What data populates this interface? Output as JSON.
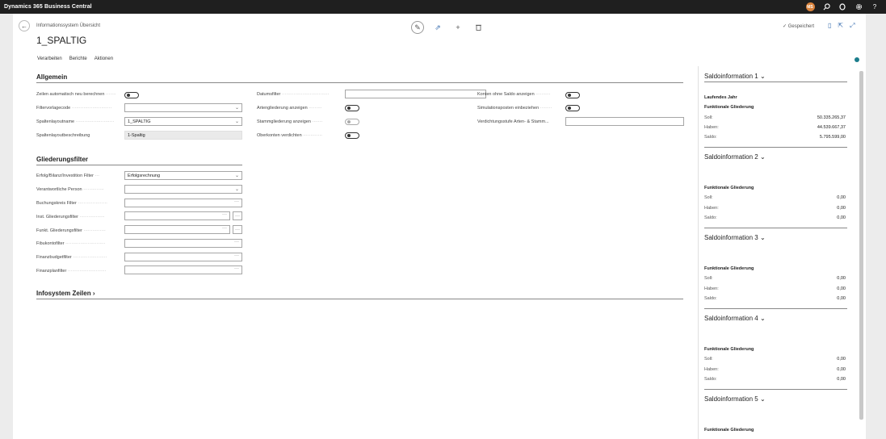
{
  "app": {
    "title": "Dynamics 365 Business Central",
    "avatar_initials": "MS"
  },
  "topbar_icons": [
    "search-icon",
    "notification-icon",
    "gear-icon",
    "help-icon"
  ],
  "header": {
    "breadcrumb": "Informationssystem Übersicht",
    "title": "1_SPALTIG",
    "saved_label": "Gespeichert",
    "saved_check": "✓"
  },
  "actions": [
    "Verarbeiten",
    "Berichte",
    "Aktionen"
  ],
  "allgemein": {
    "title": "Allgemein",
    "col1": {
      "recalc_label": "Zeilen automatisch neu berechnen",
      "filtertemplate_label": "Filtervorlagecode",
      "filtertemplate_value": "",
      "layoutname_label": "Spaltenlayoutname",
      "layoutname_value": "1_SPALTIG",
      "layoutdesc_label": "Spaltenlayoutbeschreibung",
      "layoutdesc_value": "1-Spaltig"
    },
    "col2": {
      "datefilter_label": "Datumsfilter",
      "datefilter_value": "",
      "artgliederung_label": "Artengliederung anzeigen",
      "stammgliederung_label": "Stammgliederung anzeigen",
      "oberkonten_label": "Oberkonten verdichten"
    },
    "col3": {
      "ohnesaldo_label": "Konten ohne Saldo anzeigen",
      "simulation_label": "Simulationsposten einbeziehen",
      "verdichtung_label": "Verdichtungsstufe Arten- & Stamm...",
      "verdichtung_value": ""
    }
  },
  "gliederung": {
    "title": "Gliederungsfilter",
    "rows": [
      {
        "label": "Erfolg/Bilanz/Investition Filter",
        "value": "Erfolgsrechnung"
      },
      {
        "label": "Verantwortliche Person",
        "value": ""
      },
      {
        "label": "Buchungskreis Filter",
        "value": ""
      },
      {
        "label": "Inst. Gliederungsfilter",
        "value": ""
      },
      {
        "label": "Funkt. Gliederungsfilter",
        "value": ""
      },
      {
        "label": "Fibukontofilter",
        "value": ""
      },
      {
        "label": "Finanzbudgetfilter",
        "value": ""
      },
      {
        "label": "Finanzplanfilter",
        "value": ""
      }
    ]
  },
  "infosystem": {
    "title": "Infosystem Zeilen",
    "chevron": "›"
  },
  "factbox": {
    "sections": [
      {
        "title": "Saldoinformation 1",
        "year": "Laufendes Jahr",
        "sub": "Funktionale Gliederung",
        "soll_label": "Soll:",
        "soll": "50.335.265,37",
        "haben_label": "Haben:",
        "haben": "44.539.667,37",
        "saldo_label": "Saldo:",
        "saldo": "5.795.599,00"
      },
      {
        "title": "Saldoinformation 2",
        "year": "",
        "sub": "Funktionale Gliederung",
        "soll_label": "Soll:",
        "soll": "0,00",
        "haben_label": "Haben:",
        "haben": "0,00",
        "saldo_label": "Saldo:",
        "saldo": "0,00"
      },
      {
        "title": "Saldoinformation 3",
        "year": "",
        "sub": "Funktionale Gliederung",
        "soll_label": "Soll:",
        "soll": "0,00",
        "haben_label": "Haben:",
        "haben": "0,00",
        "saldo_label": "Saldo:",
        "saldo": "0,00"
      },
      {
        "title": "Saldoinformation 4",
        "year": "",
        "sub": "Funktionale Gliederung",
        "soll_label": "Soll:",
        "soll": "0,00",
        "haben_label": "Haben:",
        "haben": "0,00",
        "saldo_label": "Saldo:",
        "saldo": "0,00"
      },
      {
        "title": "Saldoinformation 5",
        "year": "",
        "sub": "Funktionale Gliederung"
      }
    ]
  },
  "colors": {
    "topbar": "#1f1f1f",
    "accent": "#3a6fb0",
    "status_dot": "#1b7d8c",
    "avatar": "#d9823b"
  }
}
